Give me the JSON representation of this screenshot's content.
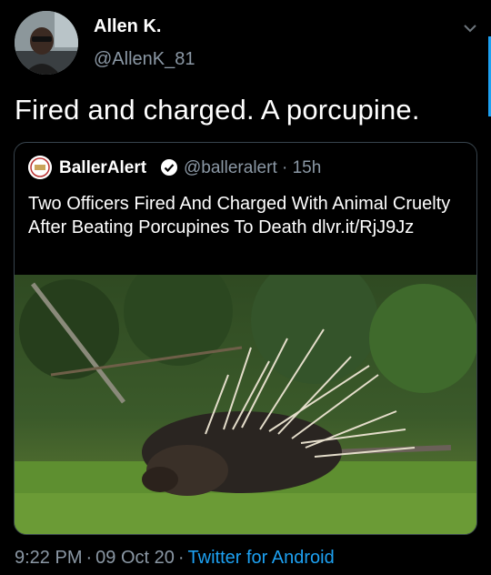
{
  "tweet": {
    "author_name": "Allen K.",
    "author_handle": "@AllenK_81",
    "text": "Fired and charged. A porcupine.",
    "time": "9:22 PM",
    "date": "09 Oct 20",
    "separator": "·",
    "client": "Twitter for Android"
  },
  "quoted": {
    "name": "BallerAlert",
    "handle": "@balleralert",
    "separator": "·",
    "age": "15h",
    "text": "Two Officers Fired And Charged With Animal Cruelty After Beating Porcupines To Death dlvr.it/RjJ9Jz"
  },
  "icons": {
    "menu": "chevron-down-icon",
    "verified": "verified-badge-icon"
  },
  "colors": {
    "background": "#000000",
    "link": "#1da1f2",
    "secondary_text": "#8b98a5",
    "border": "#38444d"
  }
}
